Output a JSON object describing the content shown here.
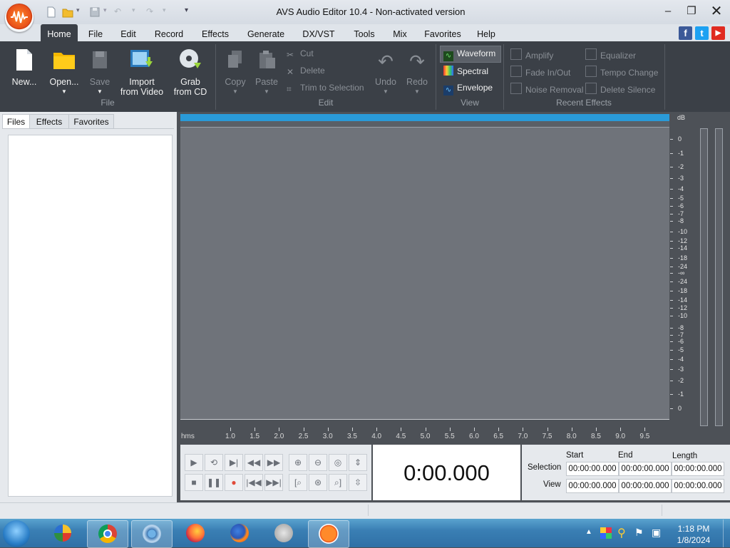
{
  "window": {
    "title": "AVS Audio Editor 10.4 - Non-activated version"
  },
  "menu": [
    "Home",
    "File",
    "Edit",
    "Record",
    "Effects",
    "Generate",
    "DX/VST",
    "Tools",
    "Mix",
    "Favorites",
    "Help"
  ],
  "ribbon": {
    "file": {
      "new": "New...",
      "open": "Open...",
      "save": "Save",
      "import_line1": "Import",
      "import_line2": "from Video",
      "grab_line1": "Grab",
      "grab_line2": "from CD",
      "label": "File"
    },
    "edit": {
      "copy": "Copy",
      "paste": "Paste",
      "cut": "Cut",
      "delete": "Delete",
      "trim": "Trim to Selection",
      "undo": "Undo",
      "redo": "Redo",
      "label": "Edit"
    },
    "view": {
      "waveform": "Waveform",
      "spectral": "Spectral",
      "envelope": "Envelope",
      "label": "View"
    },
    "recent": {
      "amplify": "Amplify",
      "fade": "Fade In/Out",
      "noise": "Noise Removal",
      "equalizer": "Equalizer",
      "tempo": "Tempo Change",
      "silence": "Delete Silence",
      "label": "Recent Effects"
    }
  },
  "left_tabs": [
    "Files",
    "Effects",
    "Favorites"
  ],
  "db": {
    "unit": "dB",
    "labels": [
      "0",
      "-1",
      "-2",
      "-3",
      "-4",
      "-5",
      "-6",
      "-7",
      "-8",
      "-10",
      "-12",
      "-14",
      "-18",
      "-24",
      "-∞",
      "-24",
      "-18",
      "-14",
      "-12",
      "-10",
      "-8",
      "-7",
      "-6",
      "-5",
      "-4",
      "-3",
      "-2",
      "-1",
      "0"
    ]
  },
  "timeline": {
    "unit": "hms",
    "ticks": [
      "1.0",
      "1.5",
      "2.0",
      "2.5",
      "3.0",
      "3.5",
      "4.0",
      "4.5",
      "5.0",
      "5.5",
      "6.0",
      "6.5",
      "7.0",
      "7.5",
      "8.0",
      "8.5",
      "9.0",
      "9.5"
    ]
  },
  "time_display": "0:00.000",
  "selection": {
    "start_hdr": "Start",
    "end_hdr": "End",
    "length_hdr": "Length",
    "sel_label": "Selection",
    "view_label": "View",
    "sel_start": "00:00:00.000",
    "sel_end": "00:00:00.000",
    "sel_length": "00:00:00.000",
    "view_start": "00:00:00.000",
    "view_end": "00:00:00.000",
    "view_length": "00:00:00.000"
  },
  "clock": {
    "time": "1:18 PM",
    "date": "1/8/2024"
  },
  "colors": {
    "accent": "#2a9ad8",
    "ribbon": "#3b4047"
  }
}
